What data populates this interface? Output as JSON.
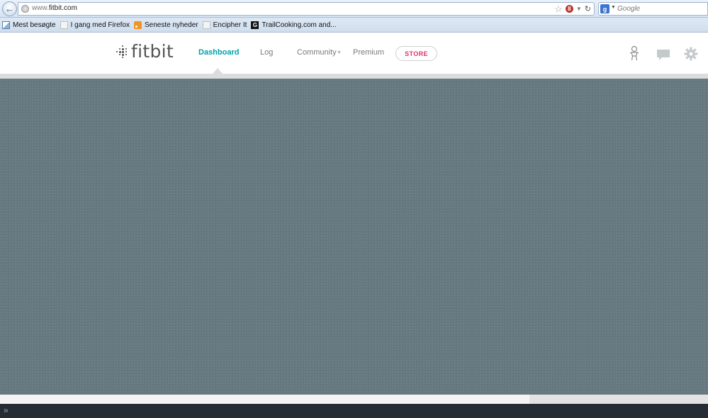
{
  "browser": {
    "url_prefix": "www.",
    "url_domain": "fitbit.com",
    "search_engine_badge": "g",
    "search_placeholder": "Google",
    "ghostery_count": "8",
    "bookmarks": [
      {
        "label": "Mest besøgte",
        "icon": "most-visited-icon"
      },
      {
        "label": "I gang med Firefox",
        "icon": "bookmark-page-icon"
      },
      {
        "label": "Seneste nyheder",
        "icon": "rss-feed-icon"
      },
      {
        "label": "Encipher It",
        "icon": "bookmark-page-icon"
      },
      {
        "label": "TrailCooking.com and...",
        "icon": "trailcooking-g-icon"
      }
    ],
    "bookmark_g_glyph": "G"
  },
  "header": {
    "logo_text": "fitbit",
    "nav": [
      {
        "label": "Dashboard",
        "active": true
      },
      {
        "label": "Log",
        "active": false
      },
      {
        "label": "Community",
        "active": false,
        "has_dropdown": true
      },
      {
        "label": "Premium",
        "active": false
      }
    ],
    "store_label": "STORE",
    "icons": [
      "avatar-icon",
      "messages-icon",
      "settings-gear-icon"
    ]
  },
  "colors": {
    "accent_teal": "#00a0a6",
    "store_pink": "#e2306c",
    "main_background": "#66787f",
    "addon_bar": "#252c33"
  }
}
